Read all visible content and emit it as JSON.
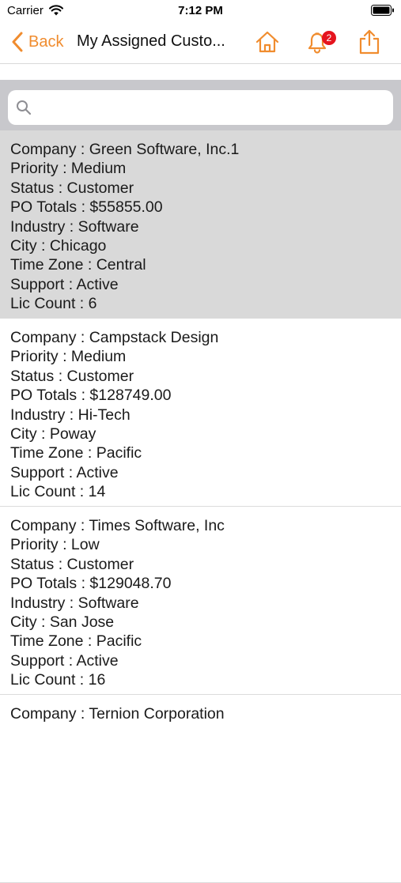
{
  "status_bar": {
    "carrier": "Carrier",
    "time": "7:12 PM"
  },
  "nav": {
    "back_label": "Back",
    "title": "My Assigned Custo...",
    "notification_count": "2",
    "accent_color": "#f08c2e",
    "badge_color": "#e5141e"
  },
  "search": {
    "value": "",
    "placeholder": ""
  },
  "customers": [
    {
      "company": "Company : Green Software, Inc.1",
      "priority": "Priority : Medium",
      "status": "Status : Customer",
      "po_totals": "PO Totals : $55855.00",
      "industry": "Industry : Software",
      "city": "City : Chicago",
      "time_zone": "Time Zone : Central",
      "support": "Support : Active",
      "lic_count": "Lic Count : 6"
    },
    {
      "company": "Company : Campstack Design",
      "priority": "Priority : Medium",
      "status": "Status : Customer",
      "po_totals": "PO Totals : $128749.00",
      "industry": "Industry : Hi-Tech",
      "city": "City : Poway",
      "time_zone": "Time Zone : Pacific",
      "support": "Support : Active",
      "lic_count": "Lic Count : 14"
    },
    {
      "company": "Company : Times Software, Inc",
      "priority": "Priority : Low",
      "status": "Status : Customer",
      "po_totals": "PO Totals : $129048.70",
      "industry": "Industry : Software",
      "city": "City : San Jose",
      "time_zone": "Time Zone : Pacific",
      "support": "Support : Active",
      "lic_count": "Lic Count : 16"
    },
    {
      "company": "Company : Ternion Corporation"
    }
  ]
}
